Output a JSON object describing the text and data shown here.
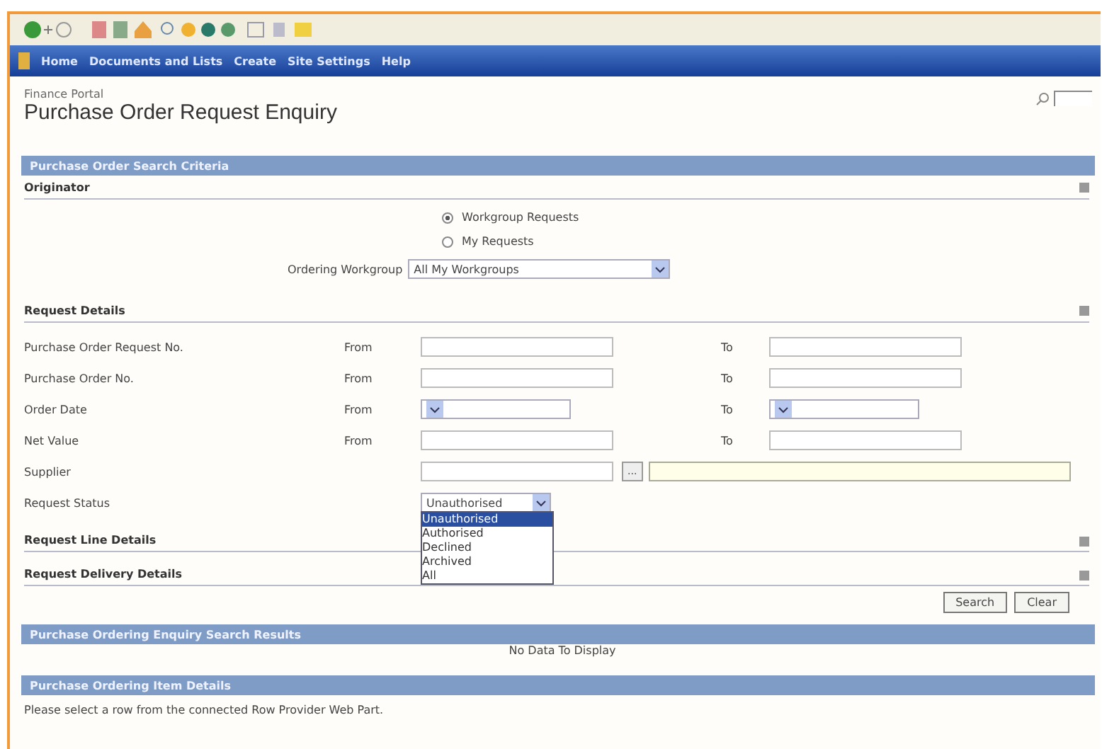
{
  "nav": [
    "Home",
    "Documents and Lists",
    "Create",
    "Site Settings",
    "Help"
  ],
  "breadcrumb": "Finance Portal",
  "page_title": "Purchase Order Request Enquiry",
  "criteria": {
    "title": "Purchase Order Search Criteria",
    "originator": {
      "title": "Originator",
      "options": [
        {
          "label": "Workgroup Requests",
          "selected": true
        },
        {
          "label": "My Requests",
          "selected": false
        }
      ],
      "workgroup_label": "Ordering Workgroup",
      "workgroup_value": "All My Workgroups"
    },
    "details": {
      "title": "Request Details",
      "rows": [
        {
          "kind": "text",
          "label": "Purchase Order Request No.",
          "from": "From",
          "to": "To"
        },
        {
          "kind": "text",
          "label": "Purchase Order No.",
          "from": "From",
          "to": "To"
        },
        {
          "kind": "date",
          "label": "Order Date",
          "from": "From",
          "to": "To"
        },
        {
          "kind": "text",
          "label": "Net Value",
          "from": "From",
          "to": "To"
        },
        {
          "kind": "supplier",
          "label": "Supplier",
          "lookup": "..."
        },
        {
          "kind": "status",
          "label": "Request Status",
          "value": "Unauthorised",
          "options": [
            {
              "label": "Unauthorised",
              "selected": true
            },
            {
              "label": "Authorised",
              "selected": false
            },
            {
              "label": "Declined",
              "selected": false
            },
            {
              "label": "Archived",
              "selected": false
            },
            {
              "label": "All",
              "selected": false
            }
          ]
        }
      ]
    },
    "collapsed": [
      "Request Line Details",
      "Request Delivery Details"
    ],
    "buttons": [
      "Search",
      "Clear"
    ]
  },
  "results": {
    "title": "Purchase Ordering Enquiry Search Results",
    "message": "No Data To Display"
  },
  "item_details": {
    "title": "Purchase Ordering Item Details",
    "message": "Please select a row from the connected Row Provider Web Part."
  }
}
